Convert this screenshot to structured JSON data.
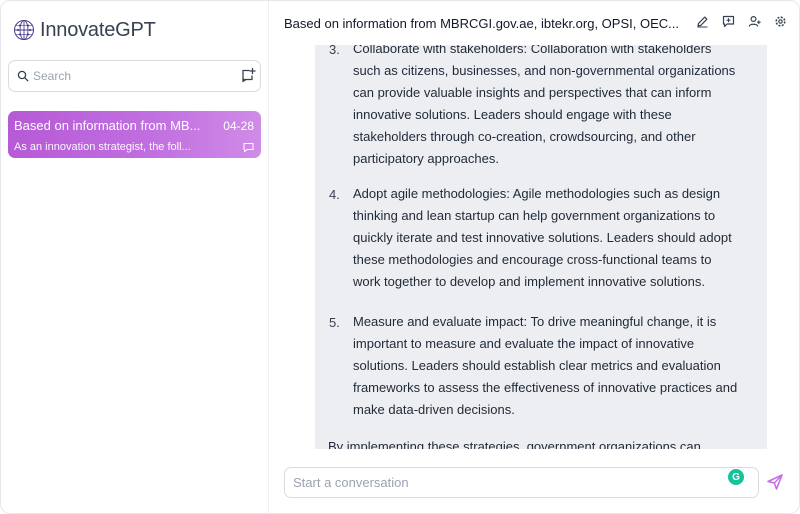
{
  "app": {
    "name": "InnovateGPT"
  },
  "sidebar": {
    "search": {
      "placeholder": "Search"
    },
    "conversations": [
      {
        "title": "Based on information from MB...",
        "date": "04-28",
        "preview": "As an innovation strategist, the foll..."
      }
    ]
  },
  "header": {
    "title": "Based on information from MBRCGI.gov.ae, ibtekr.org, OPSI, OEC..."
  },
  "message": {
    "items": [
      {
        "number": "3.",
        "lines": [
          "Collaborate with stakeholders: Collaboration with stakeholders",
          "such as citizens, businesses, and non-governmental organizations",
          "can provide valuable insights and perspectives that can inform",
          "innovative solutions. Leaders should engage with these",
          "stakeholders through co-creation, crowdsourcing, and other",
          "participatory approaches."
        ]
      },
      {
        "number": "4.",
        "lines": [
          "Adopt agile methodologies: Agile methodologies such as design",
          "thinking and lean startup can help government organizations to",
          "quickly iterate and test innovative solutions. Leaders should adopt",
          "these methodologies and encourage cross-functional teams to",
          "work together to develop and implement innovative solutions."
        ]
      },
      {
        "number": "5.",
        "lines": [
          "Measure and evaluate impact: To drive meaningful change, it is",
          "important to measure and evaluate the impact of innovative",
          "solutions. Leaders should establish clear metrics and evaluation",
          "frameworks to assess the effectiveness of innovative practices and",
          "make data-driven decisions."
        ]
      }
    ],
    "closing": "By implementing these strategies, government organizations can"
  },
  "composer": {
    "placeholder": "Start a conversation",
    "grammarly_glyph": "G"
  },
  "colors": {
    "accent": "#c06ee0",
    "send": "#c86ee6",
    "grammarly": "#15c39a"
  }
}
